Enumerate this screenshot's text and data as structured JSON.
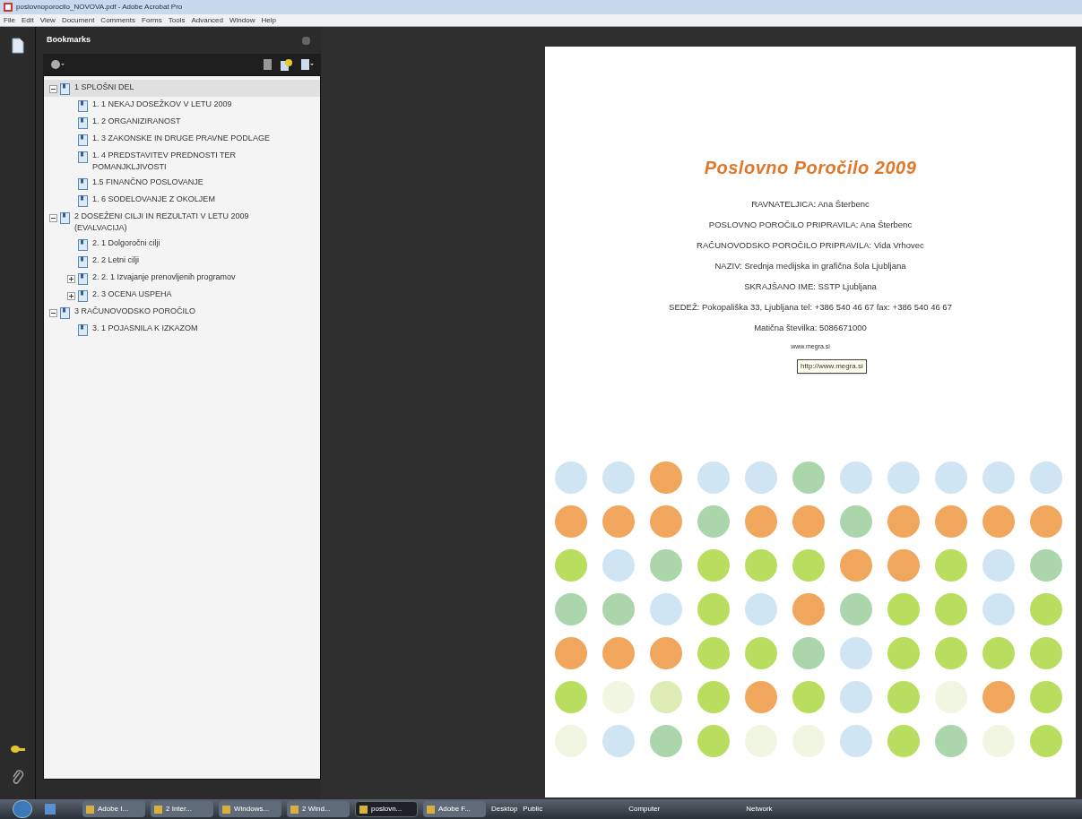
{
  "window": {
    "title": "poslovnoporocilo_NOVOVA.pdf - Adobe Acrobat Pro"
  },
  "menu": [
    "File",
    "Edit",
    "View",
    "Document",
    "Comments",
    "Forms",
    "Tools",
    "Advanced",
    "Window",
    "Help"
  ],
  "bookmarks": {
    "title": "Bookmarks",
    "items": [
      {
        "label": "1 SPLOŠNI DEL",
        "selected": true,
        "expanded": true,
        "children": [
          {
            "label": "1. 1 NEKAJ DOSEŽKOV V LETU 2009",
            "selected": false
          },
          {
            "label": "1. 2 ORGANIZIRANOST",
            "selected": false
          },
          {
            "label": "1. 3 ZAKONSKE IN DRUGE PRAVNE PODLAGE",
            "selected": false
          },
          {
            "label": "1. 4 PREDSTAVITEV PREDNOSTI TER POMANJKLJIVOSTI",
            "selected": false
          },
          {
            "label": "1.5 FINANČNO POSLOVANJE",
            "selected": false
          },
          {
            "label": "1. 6 SODELOVANJE Z OKOLJEM",
            "selected": false
          }
        ]
      },
      {
        "label": "2 DOSEŽENI CILJI IN REZULTATI V LETU 2009 (EVALVACIJA)",
        "selected": false,
        "expanded": true,
        "children": [
          {
            "label": "2. 1 Dolgoročni cilji",
            "selected": false
          },
          {
            "label": "2. 2 Letni cilji",
            "selected": false
          },
          {
            "label": "2. 2. 1 Izvajanje prenovljenih programov",
            "selected": false,
            "expanded": false
          },
          {
            "label": "2. 3 OCENA USPEHA",
            "selected": false,
            "expanded": false
          }
        ]
      },
      {
        "label": "3 RAČUNOVODSKO POROČILO",
        "selected": false,
        "expanded": true,
        "children": [
          {
            "label": "3. 1 POJASNILA K IZKAZOM",
            "selected": false
          }
        ]
      }
    ]
  },
  "page": {
    "title": "Poslovno Poročilo 2009",
    "lines": [
      "RAVNATELJICA: Ana Šterbenc",
      "POSLOVNO POROČILO PRIPRAVILA: Ana Šterbenc",
      "RAČUNOVODSKO POROČILO PRIPRAVILA: Vida Vrhovec",
      "NAZIV: Srednja medijska in grafična šola Ljubljana",
      "SKRAJŠANO IME: SSTP Ljubljana",
      "SEDEŽ: Pokopališka 33, Ljubljana tel: +386 540 46 67 fax: +386 540 46 67",
      "Matična številka: 5086671000"
    ],
    "link": "www.megra.si",
    "tooltip": "http://www.megra.si"
  },
  "taskbar": {
    "buttons": [
      {
        "label": "Adobe I...",
        "selected": false
      },
      {
        "label": "2 Inter...",
        "selected": false
      },
      {
        "label": "Windows...",
        "selected": false
      },
      {
        "label": "2 Wind...",
        "selected": false
      },
      {
        "label": "poslovn...",
        "selected": true
      },
      {
        "label": "Adobe F...",
        "selected": false
      }
    ],
    "links": [
      "Desktop",
      "Public",
      "Computer",
      "Network"
    ]
  }
}
